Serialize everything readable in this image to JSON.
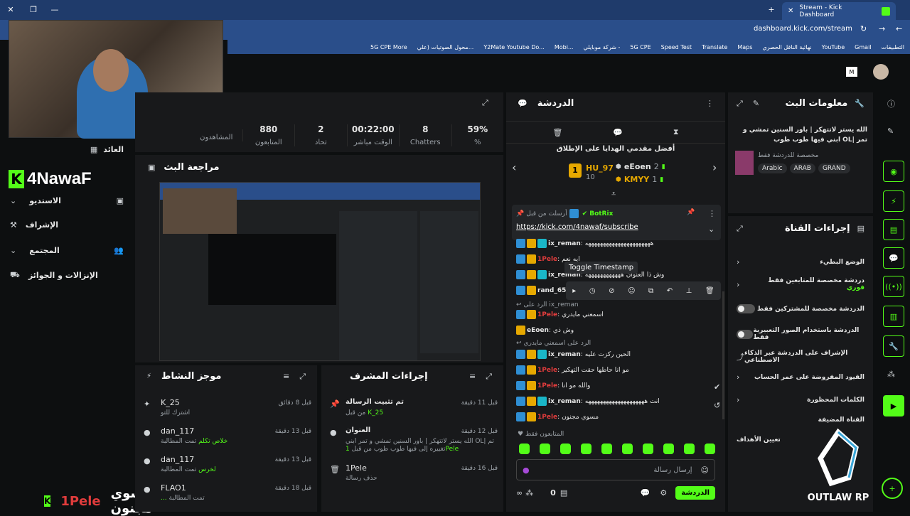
{
  "browser": {
    "tab_title": "Stream - Kick Dashboard",
    "url": "dashboard.kick.com/stream",
    "bookmarks": [
      "التطبيقات",
      "Gmail",
      "YouTube",
      "نهائية الناقل الحصري",
      "Maps",
      "Translate",
      "Speed Test",
      "5G CPE",
      "شركة موبايلي -",
      "Mobi...",
      "Y2Mate Youtube Do...",
      "محول الصوتيات (علي...",
      "5G CPE More"
    ]
  },
  "stats": [
    {
      "value": "59%",
      "label": "%"
    },
    {
      "value": "8",
      "label": "Chatters"
    },
    {
      "value": "00:22:00",
      "label": "الوقت مباشر"
    },
    {
      "value": "2",
      "label": "تحاد"
    },
    {
      "value": "880",
      "label": "المتابعون"
    },
    {
      "value": "",
      "label": "المشاهدون"
    }
  ],
  "sidebar": {
    "items": [
      {
        "label": "العائد"
      },
      {
        "label": "الاستديو"
      },
      {
        "label": "الإشراف"
      },
      {
        "label": "المجتمع"
      },
      {
        "label": "الإنزالات و الجوائز"
      }
    ],
    "streamer_name": "4NawaF"
  },
  "review": {
    "title": "مراجعة البث"
  },
  "activity": {
    "title": "موجز النشاط",
    "items": [
      {
        "user": "K_25",
        "action": "اشترك للتو",
        "time": "قبل 8 دقائق"
      },
      {
        "user": "dan_117",
        "action": "خلاص تكلم",
        "prefix": "تمت المطالبة",
        "time": "قبل 13 دقيقة"
      },
      {
        "user": "dan_117",
        "action": "لخرس",
        "prefix": "تمت المطالبة",
        "time": "قبل 13 دقيقة"
      },
      {
        "user": "FLAO1",
        "action": "...",
        "prefix": "تمت المطالبة",
        "time": "قبل 18 دقيقة"
      }
    ]
  },
  "mod_actions": {
    "title": "إجراءات المشرف",
    "items": [
      {
        "title": "تم تثبيت الرسالة",
        "sub": "من قبل",
        "user": "K_25",
        "time": "قبل 11 دقيقة"
      },
      {
        "title": "العنوان",
        "sub": "الله يستر لاتتهكر | باور السنين تمشي و تمر ابني OL| تم تغييره إلى فيها طوب طوب من قبل",
        "user": "1Pele",
        "time": "قبل 12 دقيقة"
      },
      {
        "title": "1Pele",
        "sub": "حذف رسالة",
        "user": "",
        "time": "قبل 16 دقيقة"
      }
    ]
  },
  "chat": {
    "title": "الدردشة",
    "top_gifters": "أفضل مقدمي الهدايا على الإطلاق",
    "gifters": [
      {
        "name": "HU_97",
        "count": "10",
        "rank": "1"
      },
      {
        "name": "eEoen",
        "count": "2"
      },
      {
        "name": "KMYY",
        "count": "1"
      }
    ],
    "pinned_by": "أرسلت من قبل",
    "pinned_user": "BotRix",
    "pinned_link": "https://kick.com/4nawaf/subscribe",
    "tooltip": "Toggle Timestamp",
    "messages": [
      {
        "user": "ix_reman",
        "text": "ههههههههههههههههههههههه",
        "color": "#e6e6e6"
      },
      {
        "user": "1Pele",
        "text": "ايه نعم",
        "color": "#e03c3c"
      },
      {
        "user": "ix_reman",
        "text": "وش ذا العنوان ههههههههههههه",
        "color": "#e6e6e6"
      },
      {
        "user": "rand_651",
        "text": "",
        "color": "#e6e6e6"
      },
      {
        "user": "1Pele",
        "text": "اسمعني مايدري",
        "color": "#e03c3c"
      },
      {
        "user": "eEoen",
        "text": "وش ذي",
        "color": "#e6e6e6"
      },
      {
        "user": "ix_reman",
        "text": "الحين ركزت عليه",
        "color": "#e6e6e6"
      },
      {
        "user": "1Pele",
        "text": "مو انا حاطها حقت التهكير",
        "color": "#e03c3c"
      },
      {
        "user": "1Pele",
        "text": "والله مو انا",
        "color": "#e03c3c"
      },
      {
        "user": "ix_reman",
        "text": "انت ههههههههههههههههههههه",
        "color": "#e6e6e6"
      },
      {
        "user": "1Pele",
        "text": "مسوي مجنون",
        "color": "#e03c3c"
      }
    ],
    "reply_to": "الرد على",
    "reply_user": "ix_reman",
    "reply_text2": "اسمعني مايدري",
    "followers_only": "المتابعون فقط",
    "input_placeholder": "إرسال رسالة",
    "send_label": "الدردشة",
    "viewer_count": "0"
  },
  "stream_info": {
    "title": "معلومات البث",
    "stream_title": "الله يستر لاتتهكر | باور السنين تمشي و تمر |OL ابني فيها طوب طوب",
    "category": "مخصصة للدردشة فقط",
    "tags": [
      "Arabic",
      "ARAB",
      "GRAND"
    ]
  },
  "channel_actions": {
    "title": "إجراءات القناة",
    "items": [
      {
        "label": "الوضع البطيء",
        "type": "chevron"
      },
      {
        "label": "دردشة مخصصة للمتابعين فقط",
        "sub": "فوري",
        "type": "chevron"
      },
      {
        "label": "الدردشة مخصصة للمشتركين فقط",
        "type": "toggle"
      },
      {
        "label": "الدردشة باستخدام الصور التعبيرية فقط",
        "type": "toggle"
      },
      {
        "label": "الإشراف على الدردشة عبر الذكاء الاصطناعي",
        "type": "link"
      },
      {
        "label": "القيود المفروضة على عمر الحساب",
        "type": "chevron"
      },
      {
        "label": "الكلمات المحظورة",
        "type": "chevron"
      }
    ],
    "host_label": "القناة المضيفة",
    "goals_label": "تعيين الأهداف"
  },
  "overlay": {
    "brand": "OUTLAW RP",
    "chat_user": "1Pele",
    "chat_text": "مسوي مجنون"
  }
}
